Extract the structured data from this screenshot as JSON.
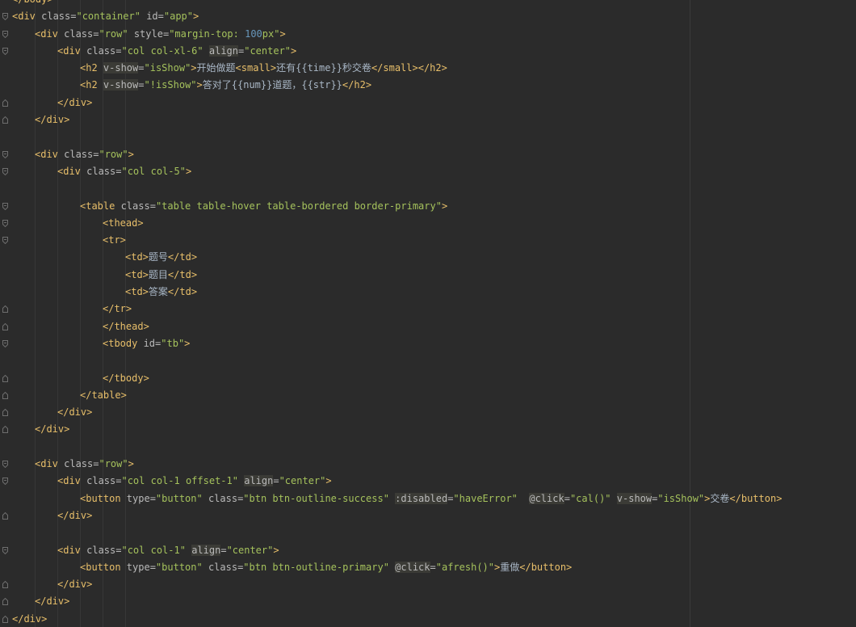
{
  "theme": {
    "background": "#2b2b2b",
    "tag": "#e8bf6a",
    "attr": "#bababa",
    "string": "#a5c25c",
    "number": "#6897bb",
    "text": "#a9b7c6",
    "directive_bg": "#3b3b36"
  },
  "lines": [
    {
      "indent": 0,
      "fold": "none",
      "tokens": [
        {
          "t": "tag",
          "v": "</body>"
        }
      ]
    },
    {
      "indent": 0,
      "fold": "open",
      "tokens": [
        {
          "t": "tag",
          "v": "<div "
        },
        {
          "t": "attr",
          "v": "class="
        },
        {
          "t": "str",
          "v": "\"container\""
        },
        {
          "t": "attr",
          "v": " id="
        },
        {
          "t": "str",
          "v": "\"app\""
        },
        {
          "t": "tag",
          "v": ">"
        }
      ]
    },
    {
      "indent": 1,
      "fold": "open",
      "tokens": [
        {
          "t": "tag",
          "v": "<div "
        },
        {
          "t": "attr",
          "v": "class="
        },
        {
          "t": "str",
          "v": "\"row\""
        },
        {
          "t": "attr",
          "v": " style="
        },
        {
          "t": "str",
          "v": "\"margin-top: "
        },
        {
          "t": "num",
          "v": "100"
        },
        {
          "t": "str",
          "v": "px\""
        },
        {
          "t": "tag",
          "v": ">"
        }
      ]
    },
    {
      "indent": 2,
      "fold": "open",
      "tokens": [
        {
          "t": "tag",
          "v": "<div "
        },
        {
          "t": "attr",
          "v": "class="
        },
        {
          "t": "str",
          "v": "\"col col-xl-6\""
        },
        {
          "t": "punct",
          "v": " "
        },
        {
          "t": "dir",
          "v": "align"
        },
        {
          "t": "attr",
          "v": "="
        },
        {
          "t": "str",
          "v": "\"center\""
        },
        {
          "t": "tag",
          "v": ">"
        }
      ]
    },
    {
      "indent": 3,
      "fold": "none",
      "tokens": [
        {
          "t": "tag",
          "v": "<h2 "
        },
        {
          "t": "dir",
          "v": "v-show"
        },
        {
          "t": "attr",
          "v": "="
        },
        {
          "t": "str",
          "v": "\"isShow\""
        },
        {
          "t": "tag",
          "v": ">"
        },
        {
          "t": "text",
          "v": "开始做题"
        },
        {
          "t": "tag",
          "v": "<small>"
        },
        {
          "t": "text",
          "v": "还有{{time}}秒交卷"
        },
        {
          "t": "tag",
          "v": "</small></h2>"
        }
      ]
    },
    {
      "indent": 3,
      "fold": "none",
      "tokens": [
        {
          "t": "tag",
          "v": "<h2 "
        },
        {
          "t": "dir",
          "v": "v-show"
        },
        {
          "t": "attr",
          "v": "="
        },
        {
          "t": "str",
          "v": "\"!isShow\""
        },
        {
          "t": "tag",
          "v": ">"
        },
        {
          "t": "text",
          "v": "答对了{{num}}道题，{{str}}"
        },
        {
          "t": "tag",
          "v": "</h2>"
        }
      ]
    },
    {
      "indent": 2,
      "fold": "close",
      "tokens": [
        {
          "t": "tag",
          "v": "</div>"
        }
      ]
    },
    {
      "indent": 1,
      "fold": "close",
      "tokens": [
        {
          "t": "tag",
          "v": "</div>"
        }
      ]
    },
    {
      "indent": 0,
      "fold": "none",
      "tokens": []
    },
    {
      "indent": 1,
      "fold": "open",
      "tokens": [
        {
          "t": "tag",
          "v": "<div "
        },
        {
          "t": "attr",
          "v": "class="
        },
        {
          "t": "str",
          "v": "\"row\""
        },
        {
          "t": "tag",
          "v": ">"
        }
      ]
    },
    {
      "indent": 2,
      "fold": "open",
      "tokens": [
        {
          "t": "tag",
          "v": "<div "
        },
        {
          "t": "attr",
          "v": "class="
        },
        {
          "t": "str",
          "v": "\"col col-5\""
        },
        {
          "t": "tag",
          "v": ">"
        }
      ]
    },
    {
      "indent": 0,
      "fold": "none",
      "tokens": []
    },
    {
      "indent": 3,
      "fold": "open",
      "tokens": [
        {
          "t": "tag",
          "v": "<table "
        },
        {
          "t": "attr",
          "v": "class="
        },
        {
          "t": "str",
          "v": "\"table table-hover table-bordered border-primary\""
        },
        {
          "t": "tag",
          "v": ">"
        }
      ]
    },
    {
      "indent": 4,
      "fold": "open",
      "tokens": [
        {
          "t": "tag",
          "v": "<thead>"
        }
      ]
    },
    {
      "indent": 4,
      "fold": "open",
      "tokens": [
        {
          "t": "tag",
          "v": "<tr>"
        }
      ]
    },
    {
      "indent": 5,
      "fold": "none",
      "tokens": [
        {
          "t": "tag",
          "v": "<td>"
        },
        {
          "t": "text",
          "v": "题号"
        },
        {
          "t": "tag",
          "v": "</td>"
        }
      ]
    },
    {
      "indent": 5,
      "fold": "none",
      "tokens": [
        {
          "t": "tag",
          "v": "<td>"
        },
        {
          "t": "text",
          "v": "题目"
        },
        {
          "t": "tag",
          "v": "</td>"
        }
      ]
    },
    {
      "indent": 5,
      "fold": "none",
      "tokens": [
        {
          "t": "tag",
          "v": "<td>"
        },
        {
          "t": "text",
          "v": "答案"
        },
        {
          "t": "tag",
          "v": "</td>"
        }
      ]
    },
    {
      "indent": 4,
      "fold": "close",
      "tokens": [
        {
          "t": "tag",
          "v": "</tr>"
        }
      ]
    },
    {
      "indent": 4,
      "fold": "close",
      "tokens": [
        {
          "t": "tag",
          "v": "</thead>"
        }
      ]
    },
    {
      "indent": 4,
      "fold": "open",
      "tokens": [
        {
          "t": "tag",
          "v": "<tbody "
        },
        {
          "t": "attr",
          "v": "id="
        },
        {
          "t": "str",
          "v": "\"tb\""
        },
        {
          "t": "tag",
          "v": ">"
        }
      ]
    },
    {
      "indent": 0,
      "fold": "none",
      "tokens": []
    },
    {
      "indent": 4,
      "fold": "close",
      "tokens": [
        {
          "t": "tag",
          "v": "</tbody>"
        }
      ]
    },
    {
      "indent": 3,
      "fold": "close",
      "tokens": [
        {
          "t": "tag",
          "v": "</table>"
        }
      ]
    },
    {
      "indent": 2,
      "fold": "close",
      "tokens": [
        {
          "t": "tag",
          "v": "</div>"
        }
      ]
    },
    {
      "indent": 1,
      "fold": "close",
      "tokens": [
        {
          "t": "tag",
          "v": "</div>"
        }
      ]
    },
    {
      "indent": 0,
      "fold": "none",
      "tokens": []
    },
    {
      "indent": 1,
      "fold": "open",
      "tokens": [
        {
          "t": "tag",
          "v": "<div "
        },
        {
          "t": "attr",
          "v": "class="
        },
        {
          "t": "str",
          "v": "\"row\""
        },
        {
          "t": "tag",
          "v": ">"
        }
      ]
    },
    {
      "indent": 2,
      "fold": "open",
      "tokens": [
        {
          "t": "tag",
          "v": "<div "
        },
        {
          "t": "attr",
          "v": "class="
        },
        {
          "t": "str",
          "v": "\"col col-1 offset-1\""
        },
        {
          "t": "punct",
          "v": " "
        },
        {
          "t": "dir",
          "v": "align"
        },
        {
          "t": "attr",
          "v": "="
        },
        {
          "t": "str",
          "v": "\"center\""
        },
        {
          "t": "tag",
          "v": ">"
        }
      ]
    },
    {
      "indent": 3,
      "fold": "none",
      "tokens": [
        {
          "t": "tag",
          "v": "<button "
        },
        {
          "t": "attr",
          "v": "type="
        },
        {
          "t": "str",
          "v": "\"button\""
        },
        {
          "t": "attr",
          "v": " class="
        },
        {
          "t": "str",
          "v": "\"btn btn-outline-success\""
        },
        {
          "t": "punct",
          "v": " "
        },
        {
          "t": "dir",
          "v": ":disabled"
        },
        {
          "t": "attr",
          "v": "="
        },
        {
          "t": "str",
          "v": "\"haveError\""
        },
        {
          "t": "punct",
          "v": "  "
        },
        {
          "t": "dir",
          "v": "@click"
        },
        {
          "t": "attr",
          "v": "="
        },
        {
          "t": "str",
          "v": "\"cal()\""
        },
        {
          "t": "punct",
          "v": " "
        },
        {
          "t": "dir",
          "v": "v-show"
        },
        {
          "t": "attr",
          "v": "="
        },
        {
          "t": "str",
          "v": "\"isShow\""
        },
        {
          "t": "tag",
          "v": ">"
        },
        {
          "t": "text",
          "v": "交卷"
        },
        {
          "t": "tag",
          "v": "</button>"
        }
      ]
    },
    {
      "indent": 2,
      "fold": "close",
      "tokens": [
        {
          "t": "tag",
          "v": "</div>"
        }
      ]
    },
    {
      "indent": 0,
      "fold": "none",
      "tokens": []
    },
    {
      "indent": 2,
      "fold": "open",
      "tokens": [
        {
          "t": "tag",
          "v": "<div "
        },
        {
          "t": "attr",
          "v": "class="
        },
        {
          "t": "str",
          "v": "\"col col-1\""
        },
        {
          "t": "punct",
          "v": " "
        },
        {
          "t": "dir",
          "v": "align"
        },
        {
          "t": "attr",
          "v": "="
        },
        {
          "t": "str",
          "v": "\"center\""
        },
        {
          "t": "tag",
          "v": ">"
        }
      ]
    },
    {
      "indent": 3,
      "fold": "none",
      "tokens": [
        {
          "t": "tag",
          "v": "<button "
        },
        {
          "t": "attr",
          "v": "type="
        },
        {
          "t": "str",
          "v": "\"button\""
        },
        {
          "t": "attr",
          "v": " class="
        },
        {
          "t": "str",
          "v": "\"btn btn-outline-primary\""
        },
        {
          "t": "punct",
          "v": " "
        },
        {
          "t": "dir",
          "v": "@click"
        },
        {
          "t": "attr",
          "v": "="
        },
        {
          "t": "str",
          "v": "\"afresh()\""
        },
        {
          "t": "tag",
          "v": ">"
        },
        {
          "t": "text",
          "v": "重做"
        },
        {
          "t": "tag",
          "v": "</button>"
        }
      ]
    },
    {
      "indent": 2,
      "fold": "close",
      "tokens": [
        {
          "t": "tag",
          "v": "</div>"
        }
      ]
    },
    {
      "indent": 1,
      "fold": "close",
      "tokens": [
        {
          "t": "tag",
          "v": "</div>"
        }
      ]
    },
    {
      "indent": 0,
      "fold": "close",
      "tokens": [
        {
          "t": "tag",
          "v": "</div>"
        }
      ]
    }
  ]
}
